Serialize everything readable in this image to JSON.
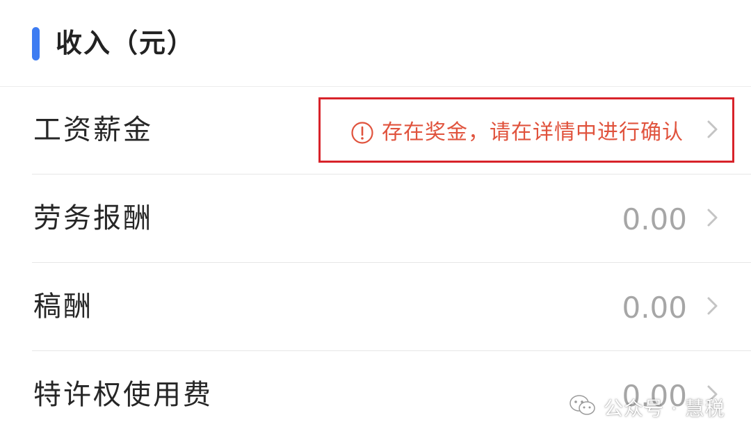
{
  "section": {
    "title": "收入（元）",
    "accent_color": "#3d7cf2"
  },
  "rows": [
    {
      "label": "工资薪金",
      "value": "",
      "warning": {
        "icon": "alert-circle-icon",
        "text": "存在奖金，请在详情中进行确认",
        "color": "#e0533d",
        "highlight_color": "#d8232a"
      },
      "chevron": "chevron-right-icon"
    },
    {
      "label": "劳务报酬",
      "value": "0.00",
      "chevron": "chevron-right-icon"
    },
    {
      "label": "稿酬",
      "value": "0.00",
      "chevron": "chevron-right-icon"
    },
    {
      "label": "特许权使用费",
      "value": "0.00",
      "chevron": "chevron-right-icon"
    }
  ],
  "watermark": {
    "icon": "wechat-icon",
    "text": "公众号 · 慧税"
  }
}
